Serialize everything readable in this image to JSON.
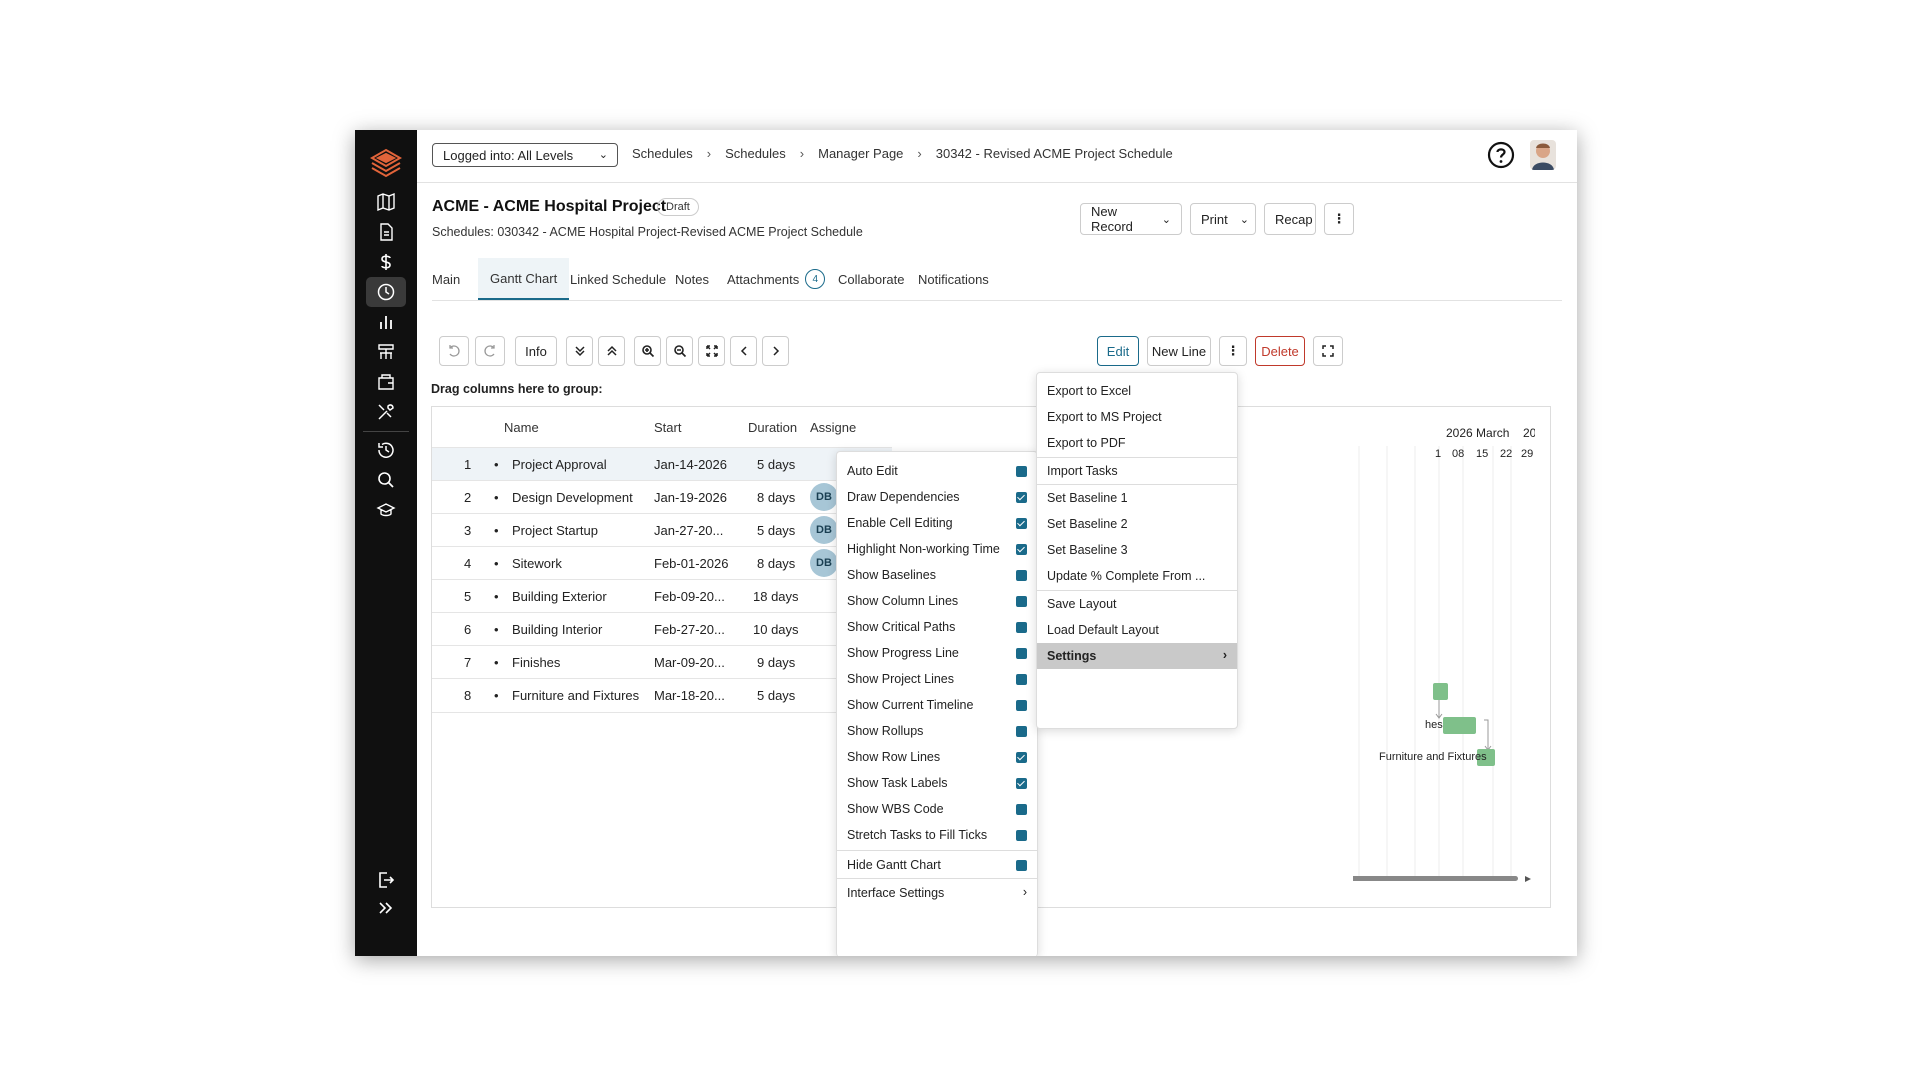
{
  "topbar": {
    "login_label": "Logged into: All Levels",
    "breadcrumbs": [
      "Schedules",
      "Schedules",
      "Manager Page",
      "30342 - Revised ACME Project Schedule"
    ]
  },
  "header": {
    "title": "ACME - ACME Hospital Project",
    "status": "Draft",
    "subtitle": "Schedules: 030342 - ACME Hospital Project-Revised ACME Project Schedule",
    "buttons": {
      "new_record": "New Record",
      "print": "Print",
      "recap": "Recap"
    }
  },
  "tabs": [
    "Main",
    "Gantt Chart",
    "Linked Schedule",
    "Notes",
    "Attachments",
    "Collaborate",
    "Notifications"
  ],
  "attachments_count": "4",
  "toolbar": {
    "info": "Info",
    "edit": "Edit",
    "new_line": "New Line",
    "delete": "Delete"
  },
  "grid": {
    "drag_text": "Drag columns here to group:",
    "headers": {
      "name": "Name",
      "start": "Start",
      "duration": "Duration",
      "assignee": "Assigne"
    },
    "rows": [
      {
        "num": "1",
        "name": "Project Approval",
        "start": "Jan-14-2026",
        "duration": "5 days",
        "assignee": ""
      },
      {
        "num": "2",
        "name": "Design Development",
        "start": "Jan-19-2026",
        "duration": "8 days",
        "assignee": "DB"
      },
      {
        "num": "3",
        "name": "Project Startup",
        "start": "Jan-27-20...",
        "duration": "5 days",
        "assignee": "DB"
      },
      {
        "num": "4",
        "name": "Sitework",
        "start": "Feb-01-2026",
        "duration": "8 days",
        "assignee": "DB"
      },
      {
        "num": "5",
        "name": "Building Exterior",
        "start": "Feb-09-20...",
        "duration": "18 days",
        "assignee": ""
      },
      {
        "num": "6",
        "name": "Building Interior",
        "start": "Feb-27-20...",
        "duration": "10 days",
        "assignee": ""
      },
      {
        "num": "7",
        "name": "Finishes",
        "start": "Mar-09-20...",
        "duration": "9 days",
        "assignee": ""
      },
      {
        "num": "8",
        "name": "Furniture and Fixtures",
        "start": "Mar-18-20...",
        "duration": "5 days",
        "assignee": ""
      }
    ]
  },
  "gantt": {
    "month_label": "2026 March",
    "month_label_next": "20",
    "days": [
      "1",
      "08",
      "15",
      "22",
      "29"
    ],
    "bar_labels": {
      "finishes_partial": "hes",
      "furniture": "Furniture and Fixtures"
    }
  },
  "settings_menu": {
    "items": [
      {
        "label": "Auto Edit",
        "checked": false
      },
      {
        "label": "Draw Dependencies",
        "checked": true
      },
      {
        "label": "Enable Cell Editing",
        "checked": true
      },
      {
        "label": "Highlight Non-working Time",
        "checked": true
      },
      {
        "label": "Show Baselines",
        "checked": false
      },
      {
        "label": "Show Column Lines",
        "checked": false
      },
      {
        "label": "Show Critical Paths",
        "checked": false
      },
      {
        "label": "Show Progress Line",
        "checked": false
      },
      {
        "label": "Show Project Lines",
        "checked": false
      },
      {
        "label": "Show Current Timeline",
        "checked": false
      },
      {
        "label": "Show Rollups",
        "checked": false
      },
      {
        "label": "Show Row Lines",
        "checked": true
      },
      {
        "label": "Show Task Labels",
        "checked": true
      },
      {
        "label": "Show WBS Code",
        "checked": false
      },
      {
        "label": "Stretch Tasks to Fill Ticks",
        "checked": false
      }
    ],
    "hide_gantt": "Hide Gantt Chart",
    "interface_settings": "Interface Settings"
  },
  "more_menu": {
    "export_excel": "Export to Excel",
    "export_ms": "Export to MS Project",
    "export_pdf": "Export to PDF",
    "import_tasks": "Import Tasks",
    "baseline1": "Set Baseline 1",
    "baseline2": "Set Baseline 2",
    "baseline3": "Set Baseline 3",
    "update_pct": "Update % Complete From ...",
    "save_layout": "Save Layout",
    "load_default": "Load Default Layout",
    "settings": "Settings"
  },
  "colors": {
    "accent": "#1a6a8a",
    "delete": "#c0392b",
    "bar": "#7fc08a",
    "sidebar": "#101010"
  }
}
